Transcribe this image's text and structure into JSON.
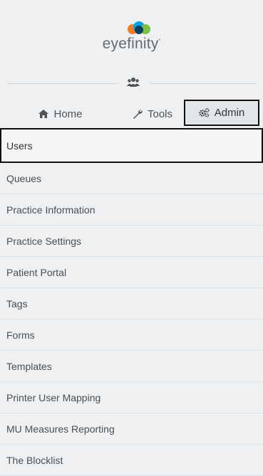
{
  "brand": {
    "name": "eyefinity",
    "tm": "*",
    "dot_colors": [
      "#f47b20",
      "#00a3e0",
      "#7ac143"
    ]
  },
  "divider": {
    "icon": "users-group-icon"
  },
  "tabs": [
    {
      "id": "home",
      "label": "Home",
      "icon": "home-icon"
    },
    {
      "id": "tools",
      "label": "Tools",
      "icon": "wrench-icon"
    },
    {
      "id": "admin",
      "label": "Admin",
      "icon": "gears-icon",
      "active": true
    }
  ],
  "menu": {
    "selected": "Users",
    "items": [
      "Users",
      "Queues",
      "Practice Information",
      "Practice Settings",
      "Patient Portal",
      "Tags",
      "Forms",
      "Templates",
      "Printer User Mapping",
      "MU Measures Reporting",
      "The Blocklist"
    ]
  },
  "colors": {
    "panel_bg": "#eef0f1",
    "text": "#4a4f54",
    "selection_border": "#111111"
  }
}
